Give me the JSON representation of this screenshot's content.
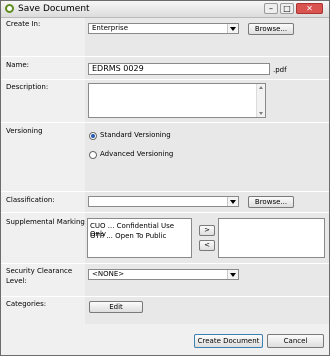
{
  "window": {
    "title": "Save Document",
    "min_glyph": "–",
    "max_glyph": "□",
    "close_glyph": "✕"
  },
  "create_in": {
    "label": "Create In:",
    "value": "Enterprise",
    "browse": "Browse..."
  },
  "name": {
    "label": "Name:",
    "value": "EDRMS 0029",
    "extension": ".pdf"
  },
  "description": {
    "label": "Description:",
    "value": ""
  },
  "versioning": {
    "label": "Versioning",
    "options": [
      "Standard Versioning",
      "Advanced Versioning"
    ],
    "selected": "Standard Versioning"
  },
  "classification": {
    "label": "Classification:",
    "value": "",
    "browse": "Browse..."
  },
  "supplemental": {
    "label": "Supplemental Markings:",
    "available": [
      "CUO ... Confidential Use Only",
      "OTP ... Open To Public"
    ],
    "add": ">",
    "remove": "<",
    "selected": []
  },
  "security": {
    "label_line1": "Security Clearance",
    "label_line2": "Level:",
    "value": "<NONE>"
  },
  "categories": {
    "label": "Categories:",
    "edit": "Edit"
  },
  "footer": {
    "create": "Create Document",
    "cancel": "Cancel"
  }
}
